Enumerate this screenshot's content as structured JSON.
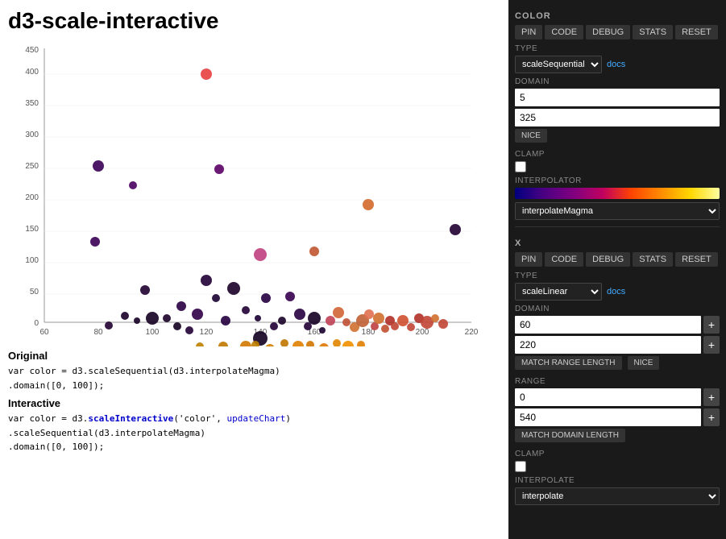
{
  "page": {
    "title": "d3-scale-interactive"
  },
  "left": {
    "original_label": "Original",
    "original_code_line1": "var color = d3.scaleSequential(d3.interpolateMagma)",
    "original_code_line2": "  .domain([0, 100]);",
    "interactive_label": "Interactive",
    "interactive_code_line1": "var color = d3.scaleInteractive('color', updateChart)",
    "interactive_code_line2": "  .scaleSequential(d3.interpolateMagma)",
    "interactive_code_line3": "  .domain([0, 100]);"
  },
  "right": {
    "color_section": {
      "title": "COLOR",
      "buttons": [
        "PIN",
        "CODE",
        "DEBUG",
        "STATS",
        "RESET"
      ],
      "type_label": "TYPE",
      "type_value": "scaleSequential",
      "docs_text": "docs",
      "domain_label": "DOMAIN",
      "domain_min": "5",
      "domain_max": "325",
      "nice_btn": "NICE",
      "clamp_label": "CLAMP",
      "interpolator_label": "INTERPOLATOR",
      "interpolator_value": "interpolateMagma"
    },
    "x_section": {
      "title": "X",
      "buttons": [
        "PIN",
        "CODE",
        "DEBUG",
        "STATS",
        "RESET"
      ],
      "type_label": "TYPE",
      "type_value": "scaleLinear",
      "docs_text": "docs",
      "domain_label": "DOMAIN",
      "domain_min": "60",
      "domain_max": "220",
      "match_range_btn": "MATCH RANGE LENGTH",
      "nice_btn": "NICE",
      "range_label": "RANGE",
      "range_min": "0",
      "range_max": "540",
      "match_domain_btn": "MATCH DOMAIN LENGTH",
      "clamp_label": "CLAMP",
      "interpolate_label": "INTERPOLATE",
      "interpolate_value": "interpolate"
    }
  },
  "chart": {
    "x_axis_labels": [
      "60",
      "80",
      "100",
      "120",
      "140",
      "160",
      "180",
      "200",
      "220"
    ],
    "y_axis_labels": [
      "0",
      "50",
      "100",
      "150",
      "200",
      "250",
      "300",
      "350",
      "400",
      "450"
    ]
  }
}
